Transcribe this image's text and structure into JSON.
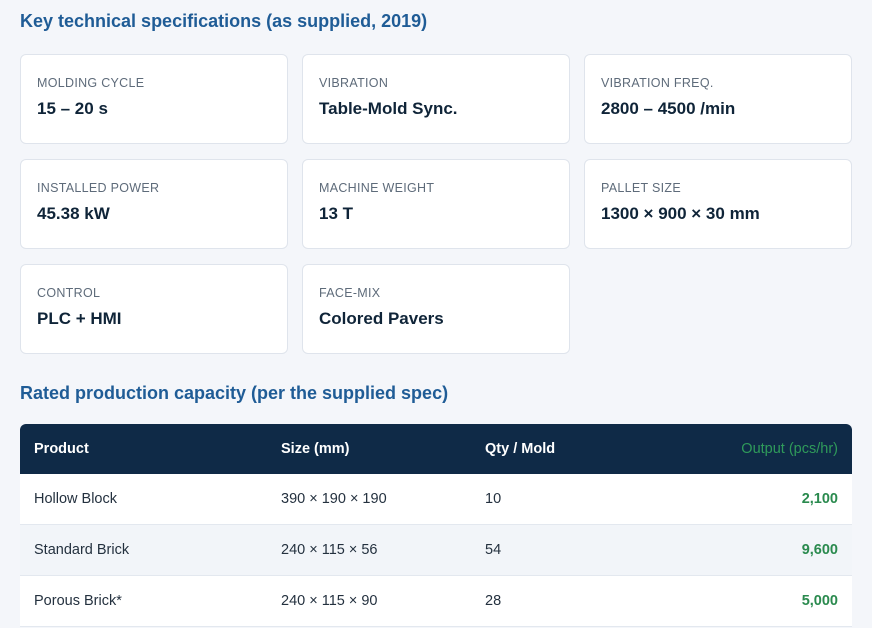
{
  "specs": {
    "title": "Key technical specifications (as supplied, 2019)",
    "cards": [
      {
        "label": "MOLDING CYCLE",
        "value": "15 – 20 s"
      },
      {
        "label": "VIBRATION",
        "value": "Table-Mold Sync."
      },
      {
        "label": "VIBRATION FREQ.",
        "value": "2800 – 4500 /min"
      },
      {
        "label": "INSTALLED POWER",
        "value": "45.38 kW"
      },
      {
        "label": "MACHINE WEIGHT",
        "value": "13 T"
      },
      {
        "label": "PALLET SIZE",
        "value": "1300 × 900 × 30 mm"
      },
      {
        "label": "CONTROL",
        "value": "PLC + HMI"
      },
      {
        "label": "FACE-MIX",
        "value": "Colored Pavers"
      }
    ]
  },
  "capacity": {
    "title": "Rated production capacity (per the supplied spec)",
    "headers": [
      "Product",
      "Size (mm)",
      "Qty / Mold",
      "Output (pcs/hr)"
    ],
    "rows": [
      {
        "product": "Hollow Block",
        "size": "390 × 190 × 190",
        "qty": "10",
        "output": "2,100"
      },
      {
        "product": "Standard Brick",
        "size": "240 × 115 × 56",
        "qty": "54",
        "output": "9,600"
      },
      {
        "product": "Porous Brick*",
        "size": "240 × 115 × 90",
        "qty": "28",
        "output": "5,000"
      }
    ]
  }
}
